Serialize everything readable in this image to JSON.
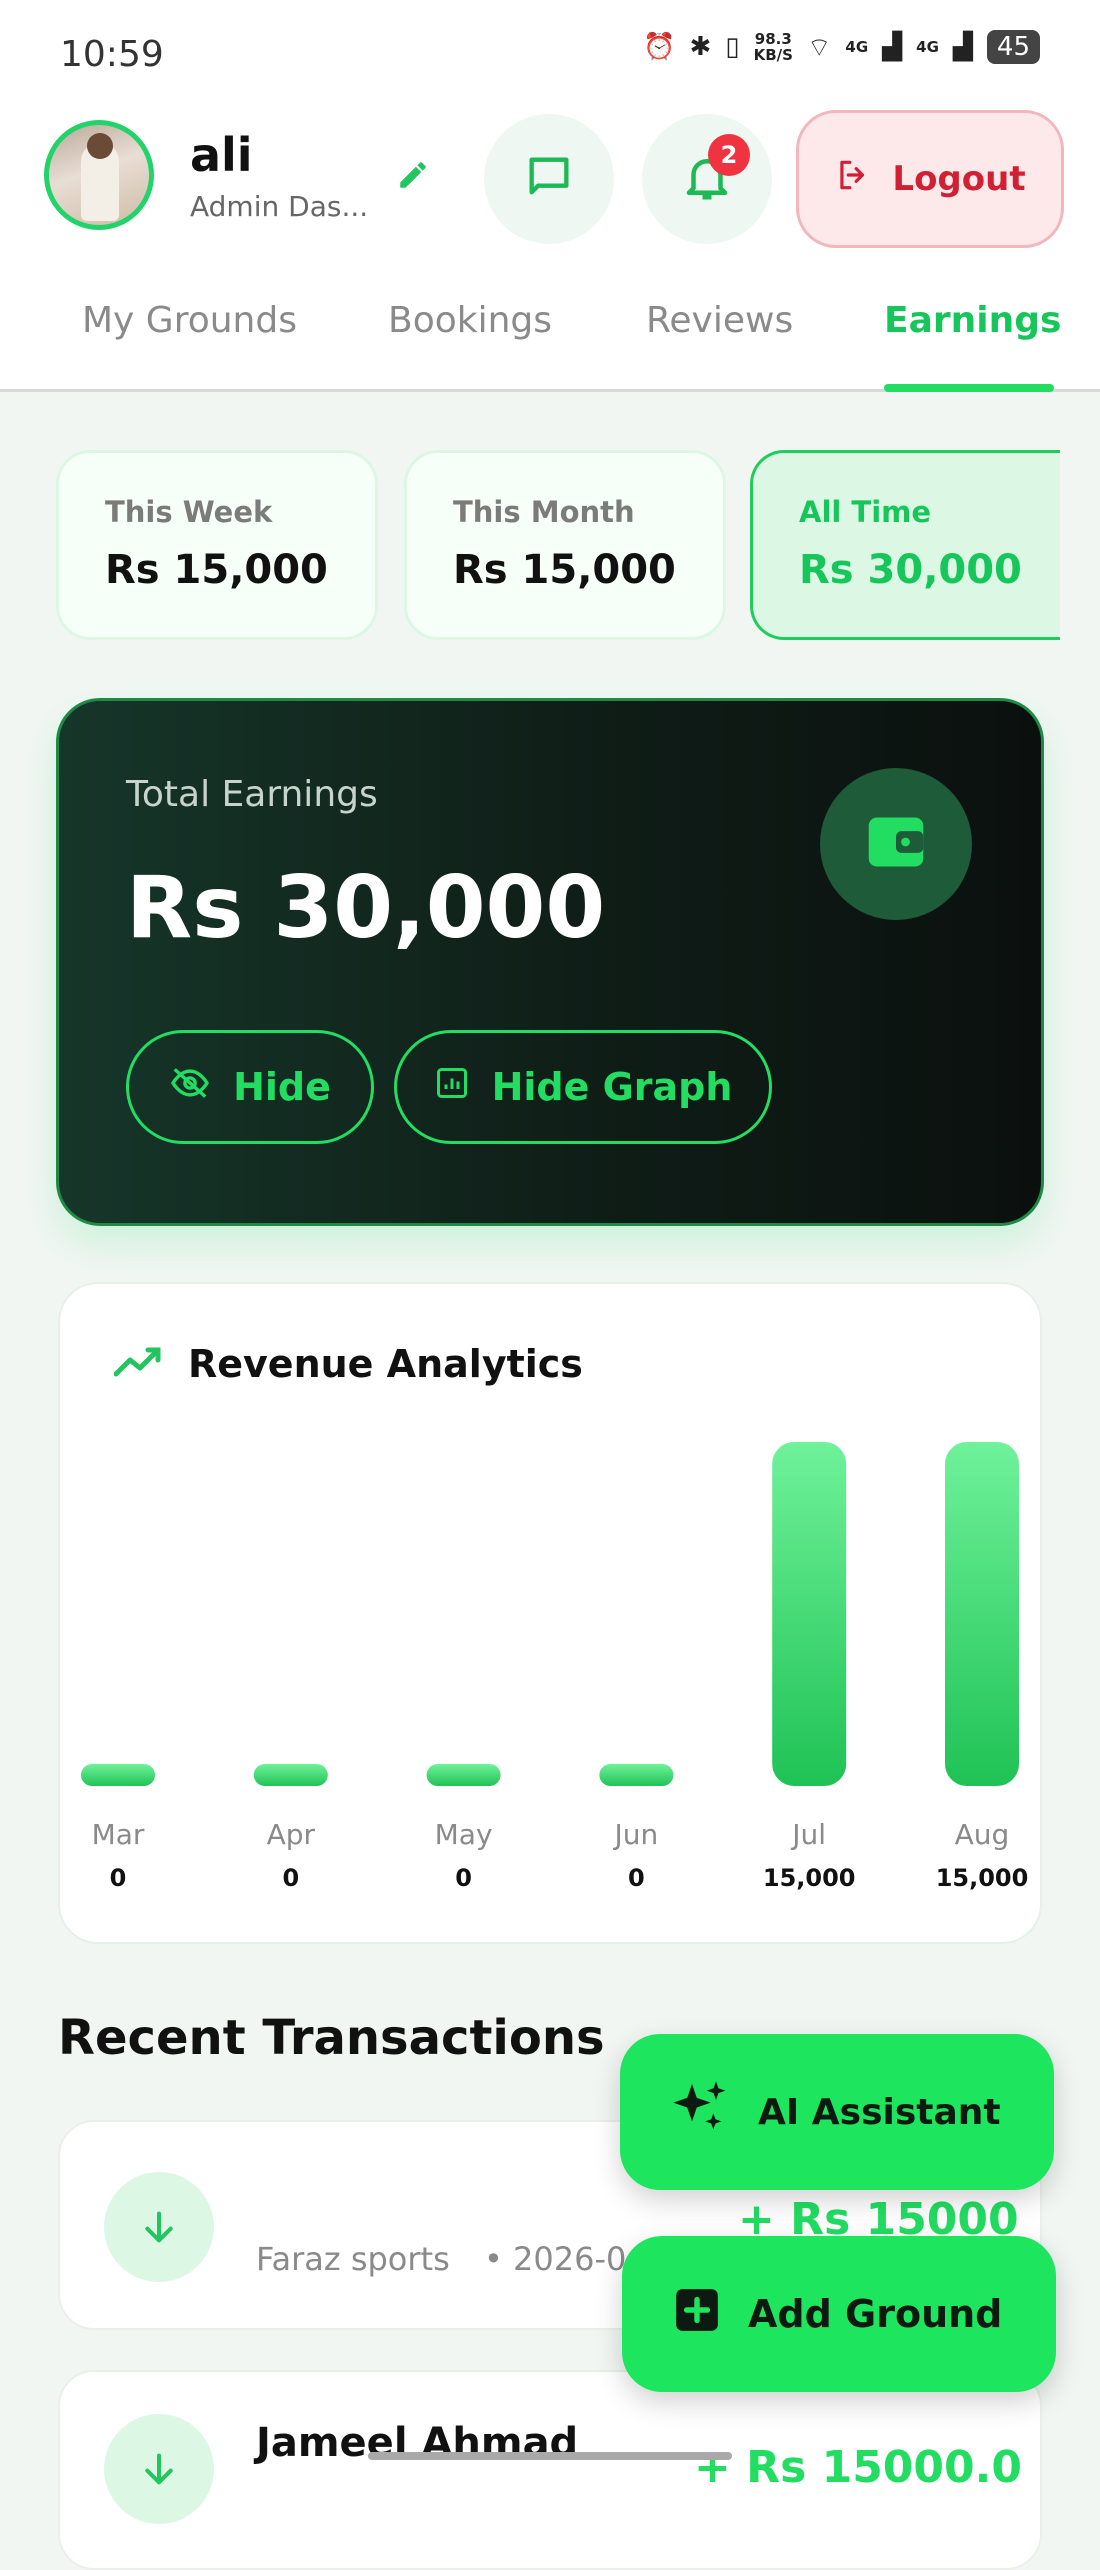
{
  "status_bar": {
    "time": "10:59",
    "net_speed_value": "98.3",
    "net_speed_unit": "KB/S",
    "net_label_1": "4G",
    "net_label_2": "4G",
    "battery": "45"
  },
  "header": {
    "user_name": "ali",
    "user_role": "Admin Das...",
    "notification_count": "2",
    "logout_label": "Logout"
  },
  "tabs": [
    {
      "label": "My Grounds",
      "active": false
    },
    {
      "label": "Bookings",
      "active": false
    },
    {
      "label": "Reviews",
      "active": false
    },
    {
      "label": "Earnings",
      "active": true
    }
  ],
  "periods": [
    {
      "label": "This Week",
      "value": "Rs 15,000",
      "active": false
    },
    {
      "label": "This Month",
      "value": "Rs 15,000",
      "active": false
    },
    {
      "label": "All Time",
      "value": "Rs 30,000",
      "active": true
    }
  ],
  "total": {
    "label": "Total Earnings",
    "value": "Rs 30,000",
    "hide_label": "Hide",
    "hide_graph_label": "Hide Graph"
  },
  "analytics": {
    "title": "Revenue Analytics"
  },
  "chart_data": {
    "type": "bar",
    "title": "Revenue Analytics",
    "categories": [
      "Mar",
      "Apr",
      "May",
      "Jun",
      "Jul",
      "Aug"
    ],
    "values": [
      0,
      0,
      0,
      0,
      15000,
      15000
    ],
    "value_labels": [
      "0",
      "0",
      "0",
      "0",
      "15,000",
      "15,000"
    ],
    "ylim": [
      0,
      15000
    ],
    "grid": false,
    "bar_color": "#22dd62"
  },
  "transactions": {
    "title": "Recent Transactions",
    "items": [
      {
        "name": "",
        "sub": "Faraz sports",
        "date": "• 2026-0",
        "amount": "+ Rs 15000"
      },
      {
        "name": "Jameel Ahmad",
        "sub": "",
        "date": "",
        "amount": "+ Rs 15000.0"
      }
    ]
  },
  "fabs": {
    "ai_label": "AI Assistant",
    "add_label": "Add Ground"
  },
  "colors": {
    "accent": "#22dd62",
    "danger": "#d11f34",
    "dark_card": "#0f1d17"
  }
}
